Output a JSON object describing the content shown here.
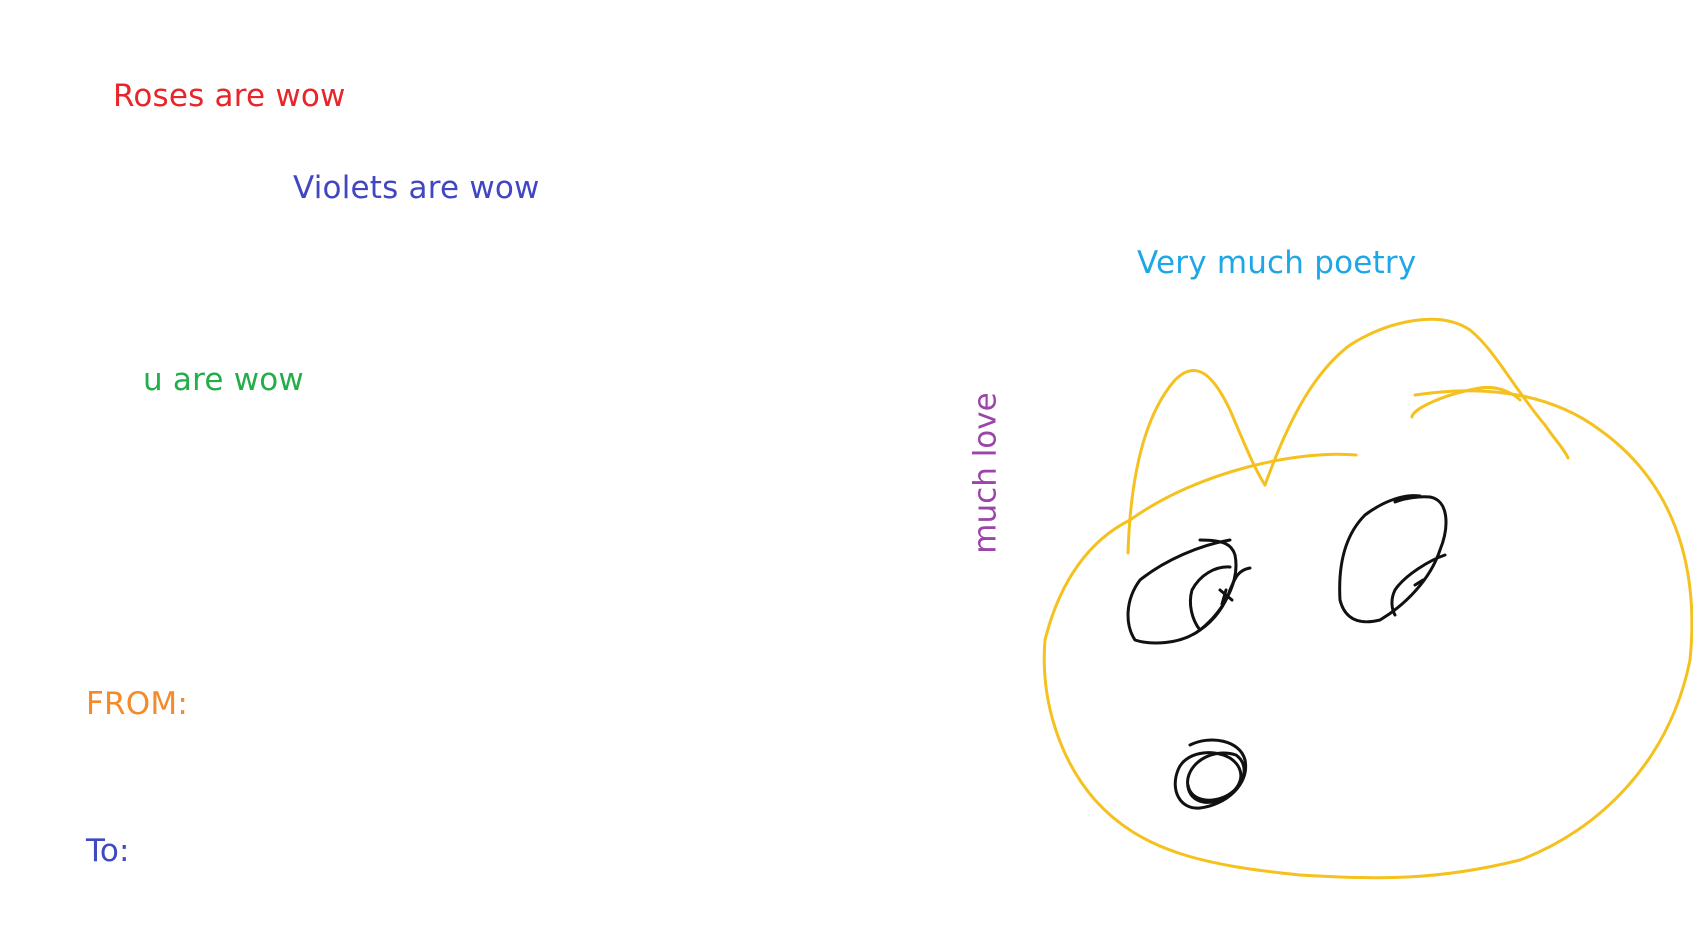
{
  "lines": {
    "roses": "Roses are wow",
    "violets": "Violets are wow",
    "poetry": "Very much poetry",
    "u_wow": "u are wow",
    "love": "much love",
    "from": "FROM:",
    "to": "To:"
  },
  "colors": {
    "roses": "#e8252a",
    "violets": "#4146c2",
    "poetry": "#1ea7e6",
    "u_wow": "#24ae4a",
    "love": "#9b45a8",
    "from": "#f58a2b",
    "to": "#3f49c2",
    "doodle_yellow": "#f5c11f",
    "doodle_black": "#111111"
  }
}
